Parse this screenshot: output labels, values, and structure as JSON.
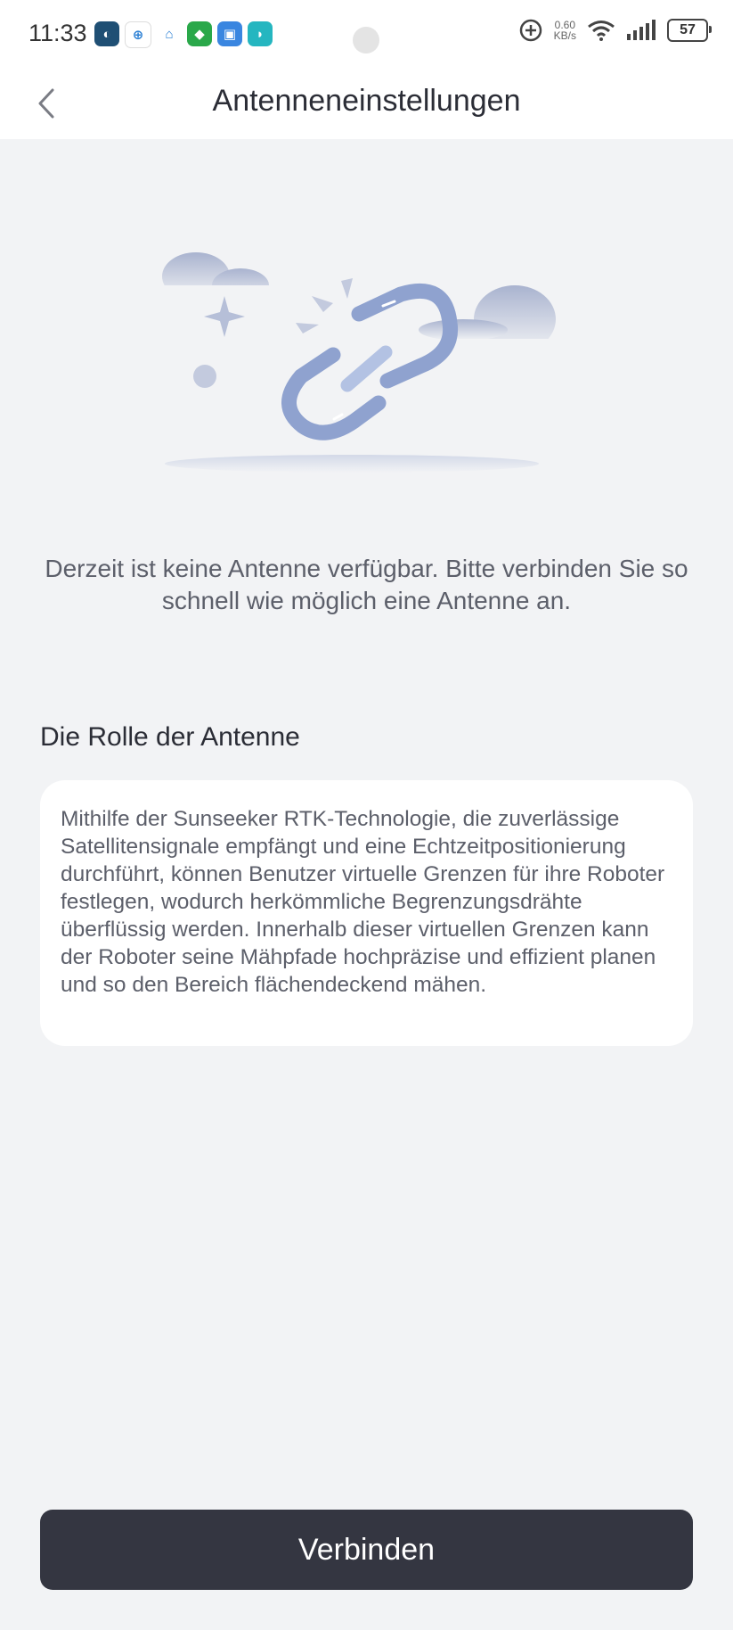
{
  "status_bar": {
    "time": "11:33",
    "net_speed_value": "0.60",
    "net_speed_unit": "KB/s",
    "battery": "57",
    "app_icons": [
      "app-icon-1",
      "app-icon-2",
      "home-app-icon",
      "shield-app-icon",
      "app-icon-5",
      "app-icon-6"
    ]
  },
  "header": {
    "title": "Antenneneinstellungen",
    "back_icon": "chevron-left-icon"
  },
  "illustration": {
    "name": "broken-link-illustration",
    "accent": "#8fa2cf"
  },
  "message": "Derzeit ist keine Antenne verfügbar. Bitte verbinden Sie so schnell wie möglich eine Antenne an.",
  "section": {
    "title": "Die Rolle der Antenne",
    "body": "Mithilfe der Sunseeker RTK-Technologie, die zuverlässige Satellitensignale empfängt und eine Echtzeitpositionierung durchführt, können Benutzer virtuelle Grenzen für ihre Roboter festlegen, wodurch herkömmliche Begrenzungsdrähte überflüssig werden. Innerhalb dieser virtuellen Grenzen kann der Roboter seine Mähpfade hochpräzise und effizient planen und so den Bereich flächendeckend mähen."
  },
  "actions": {
    "connect_label": "Verbinden"
  },
  "colors": {
    "background": "#f2f3f5",
    "button": "#343641",
    "card": "#ffffff",
    "text_secondary": "#5c5f6a"
  }
}
